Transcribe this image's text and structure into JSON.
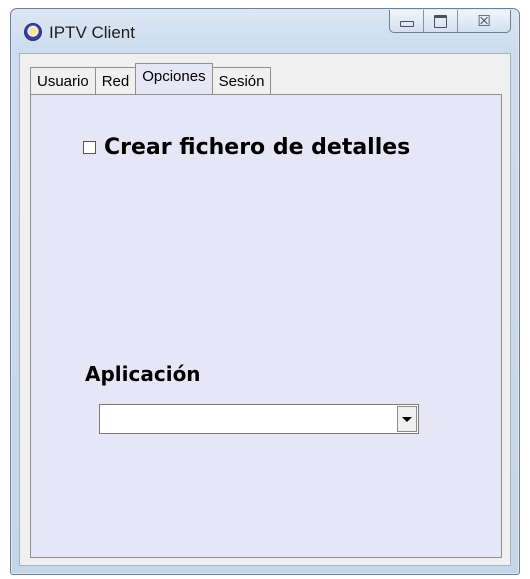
{
  "window": {
    "title": "IPTV Client",
    "minimize_icon": "minimize-icon",
    "maximize_icon": "maximize-icon",
    "close_symbol": "☒",
    "close_icon": "close-icon"
  },
  "tabs": [
    {
      "label": "Usuario",
      "active": false
    },
    {
      "label": "Red",
      "active": false
    },
    {
      "label": "Opciones",
      "active": true
    },
    {
      "label": "Sesión",
      "active": false
    }
  ],
  "options": {
    "details_checkbox_label": "Crear fichero de detalles",
    "details_checked": false,
    "application_label": "Aplicación",
    "application_value": ""
  },
  "colors": {
    "panel_background": "#e7e6f7",
    "window_frame": "#cddcee"
  }
}
